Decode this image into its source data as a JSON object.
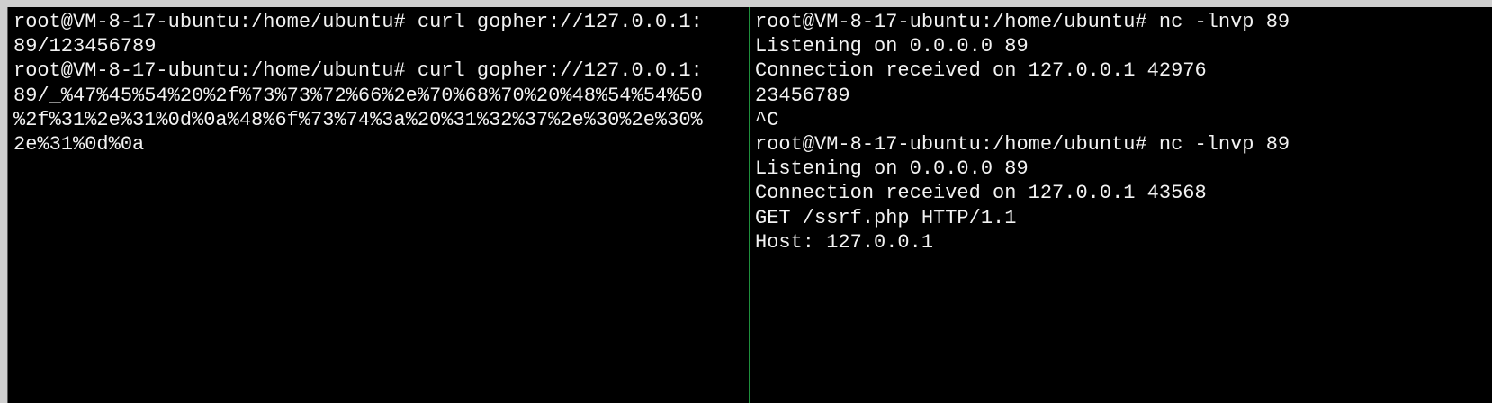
{
  "terminal": {
    "left_pane": {
      "lines": [
        "root@VM-8-17-ubuntu:/home/ubuntu# curl gopher://127.0.0.1:",
        "89/123456789",
        "root@VM-8-17-ubuntu:/home/ubuntu# curl gopher://127.0.0.1:",
        "89/_%47%45%54%20%2f%73%73%72%66%2e%70%68%70%20%48%54%54%50",
        "%2f%31%2e%31%0d%0a%48%6f%73%74%3a%20%31%32%37%2e%30%2e%30%",
        "2e%31%0d%0a"
      ]
    },
    "right_pane": {
      "lines": [
        "root@VM-8-17-ubuntu:/home/ubuntu# nc -lnvp 89",
        "Listening on 0.0.0.0 89",
        "Connection received on 127.0.0.1 42976",
        "23456789",
        "^C",
        "root@VM-8-17-ubuntu:/home/ubuntu# nc -lnvp 89",
        "Listening on 0.0.0.0 89",
        "Connection received on 127.0.0.1 43568",
        "GET /ssrf.php HTTP/1.1",
        "Host: 127.0.0.1"
      ]
    },
    "colors": {
      "background": "#000000",
      "text": "#f2f2f2",
      "divider": "#1e8f3c"
    }
  }
}
